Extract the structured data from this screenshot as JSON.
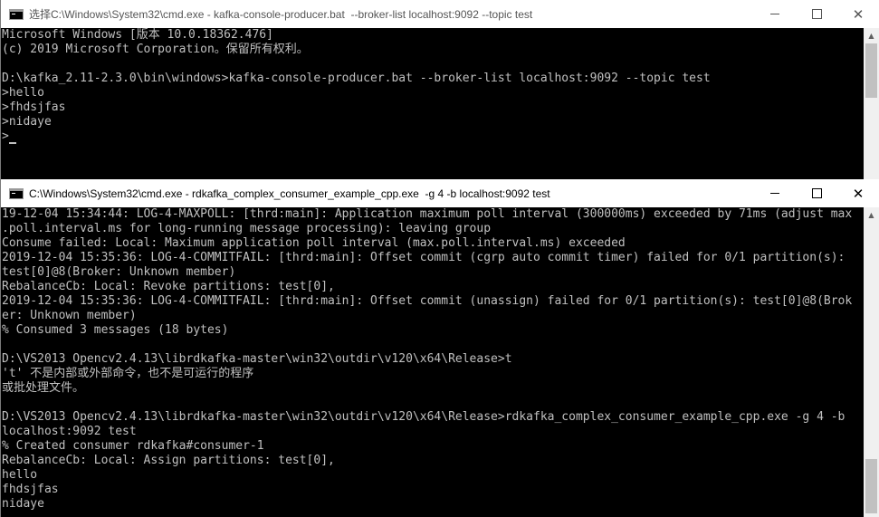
{
  "windows": [
    {
      "title": "选择C:\\Windows\\System32\\cmd.exe - kafka-console-producer.bat  --broker-list localhost:9092 --topic test",
      "lines": [
        "Microsoft Windows [版本 10.0.18362.476]",
        "(c) 2019 Microsoft Corporation。保留所有权利。",
        "",
        "D:\\kafka_2.11-2.3.0\\bin\\windows>kafka-console-producer.bat --broker-list localhost:9092 --topic test",
        ">hello",
        ">fhdsjfas",
        ">nidaye",
        ">"
      ]
    },
    {
      "title": "C:\\Windows\\System32\\cmd.exe - rdkafka_complex_consumer_example_cpp.exe  -g 4 -b localhost:9092 test",
      "lines": [
        "19-12-04 15:34:44: LOG-4-MAXPOLL: [thrd:main]: Application maximum poll interval (300000ms) exceeded by 71ms (adjust max",
        ".poll.interval.ms for long-running message processing): leaving group",
        "Consume failed: Local: Maximum application poll interval (max.poll.interval.ms) exceeded",
        "2019-12-04 15:35:36: LOG-4-COMMITFAIL: [thrd:main]: Offset commit (cgrp auto commit timer) failed for 0/1 partition(s):",
        "test[0]@8(Broker: Unknown member)",
        "RebalanceCb: Local: Revoke partitions: test[0],",
        "2019-12-04 15:35:36: LOG-4-COMMITFAIL: [thrd:main]: Offset commit (unassign) failed for 0/1 partition(s): test[0]@8(Brok",
        "er: Unknown member)",
        "% Consumed 3 messages (18 bytes)",
        "",
        "D:\\VS2013 Opencv2.4.13\\librdkafka-master\\win32\\outdir\\v120\\x64\\Release>t",
        "'t' 不是内部或外部命令，也不是可运行的程序",
        "或批处理文件。",
        "",
        "D:\\VS2013 Opencv2.4.13\\librdkafka-master\\win32\\outdir\\v120\\x64\\Release>rdkafka_complex_consumer_example_cpp.exe -g 4 -b",
        "localhost:9092 test",
        "% Created consumer rdkafka#consumer-1",
        "RebalanceCb: Local: Assign partitions: test[0],",
        "hello",
        "fhdsjfas",
        "nidaye"
      ]
    }
  ],
  "icons": {
    "app": "cmd-icon",
    "minimize": "minimize-icon",
    "maximize": "maximize-icon",
    "close": "close-icon",
    "close_glyph": "✕",
    "scroll_up": "▲",
    "scroll_down": "▼"
  },
  "colors": {
    "console_bg": "#000000",
    "console_fg": "#c0c0c0",
    "titlebar_bg": "#ffffff"
  }
}
